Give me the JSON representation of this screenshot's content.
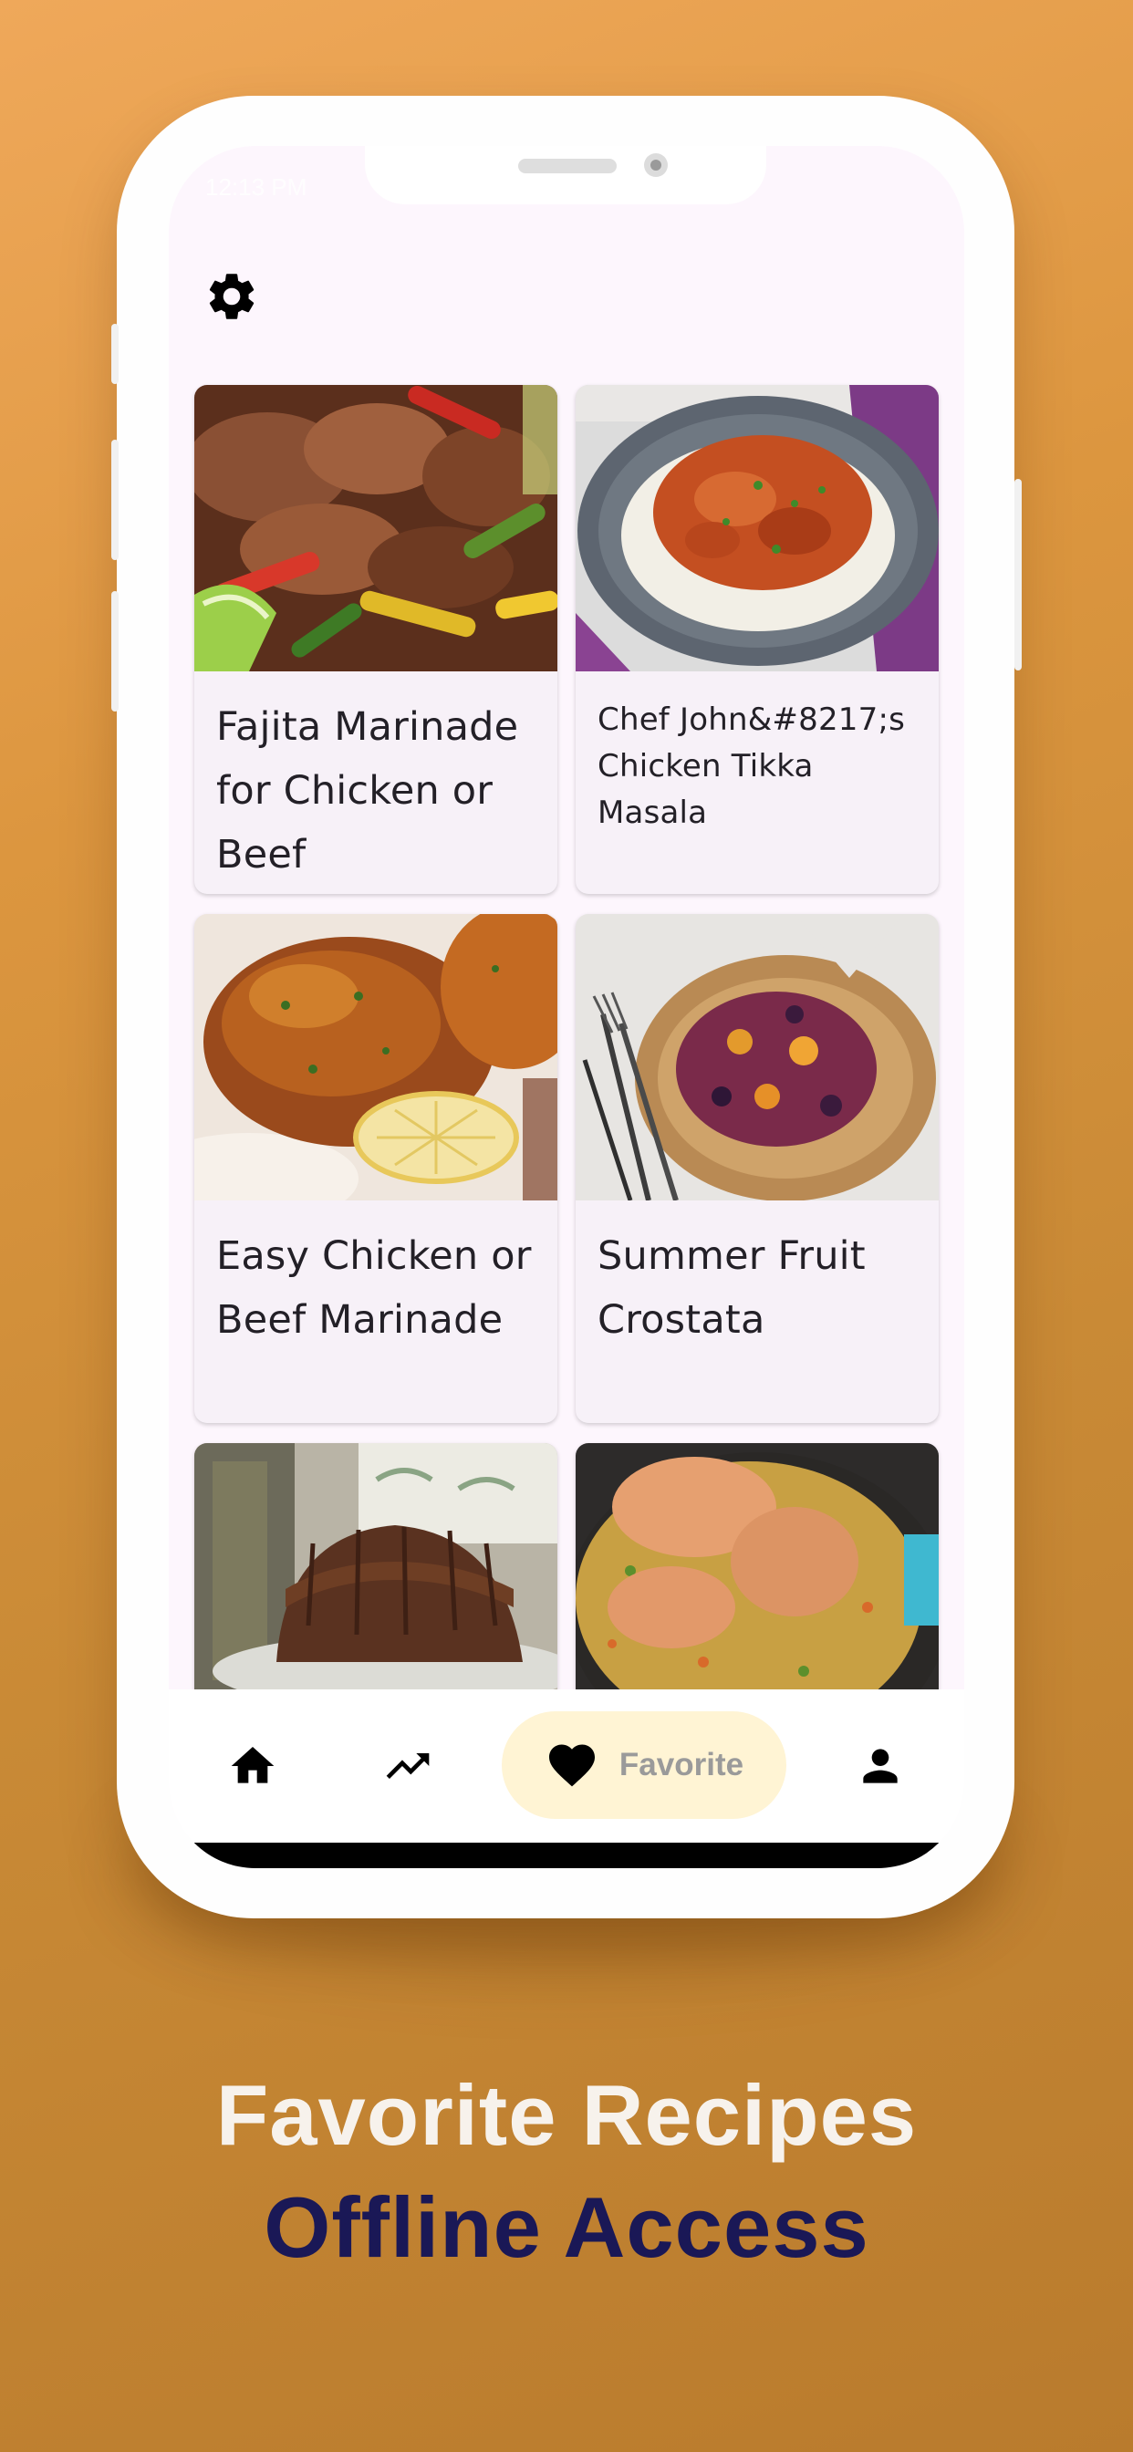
{
  "status_bar": {
    "time": "12:13 PM",
    "right": "12:13 PM"
  },
  "settings": {
    "icon": "gear-icon"
  },
  "recipes": [
    {
      "title": "Fajita Marinade for Chicken or Beef",
      "image": "fajita-chicken-peppers"
    },
    {
      "title": "Chef John&#8217;s Chicken Tikka Masala",
      "image": "tikka-masala-rice"
    },
    {
      "title": "Easy Chicken or Beef Marinade",
      "image": "glazed-chicken-lemon"
    },
    {
      "title": "Summer Fruit Crostata",
      "image": "fruit-crostata"
    },
    {
      "title": "",
      "image": "glazed-bundt-cake"
    },
    {
      "title": "",
      "image": "chicken-rice-skillet"
    }
  ],
  "bottom_nav": {
    "items": [
      {
        "icon": "home-icon"
      },
      {
        "icon": "trending-up-icon"
      },
      {
        "icon": "heart-icon",
        "label": "Favorite",
        "active": true
      },
      {
        "icon": "person-icon"
      }
    ],
    "active_color": "#fff4d4"
  },
  "promo": {
    "line1": "Favorite Recipes",
    "line2": "Offline Access"
  },
  "colors": {
    "background": "#dc963f",
    "headline_light": "#f7f2ec",
    "headline_dark": "#1a1856"
  }
}
